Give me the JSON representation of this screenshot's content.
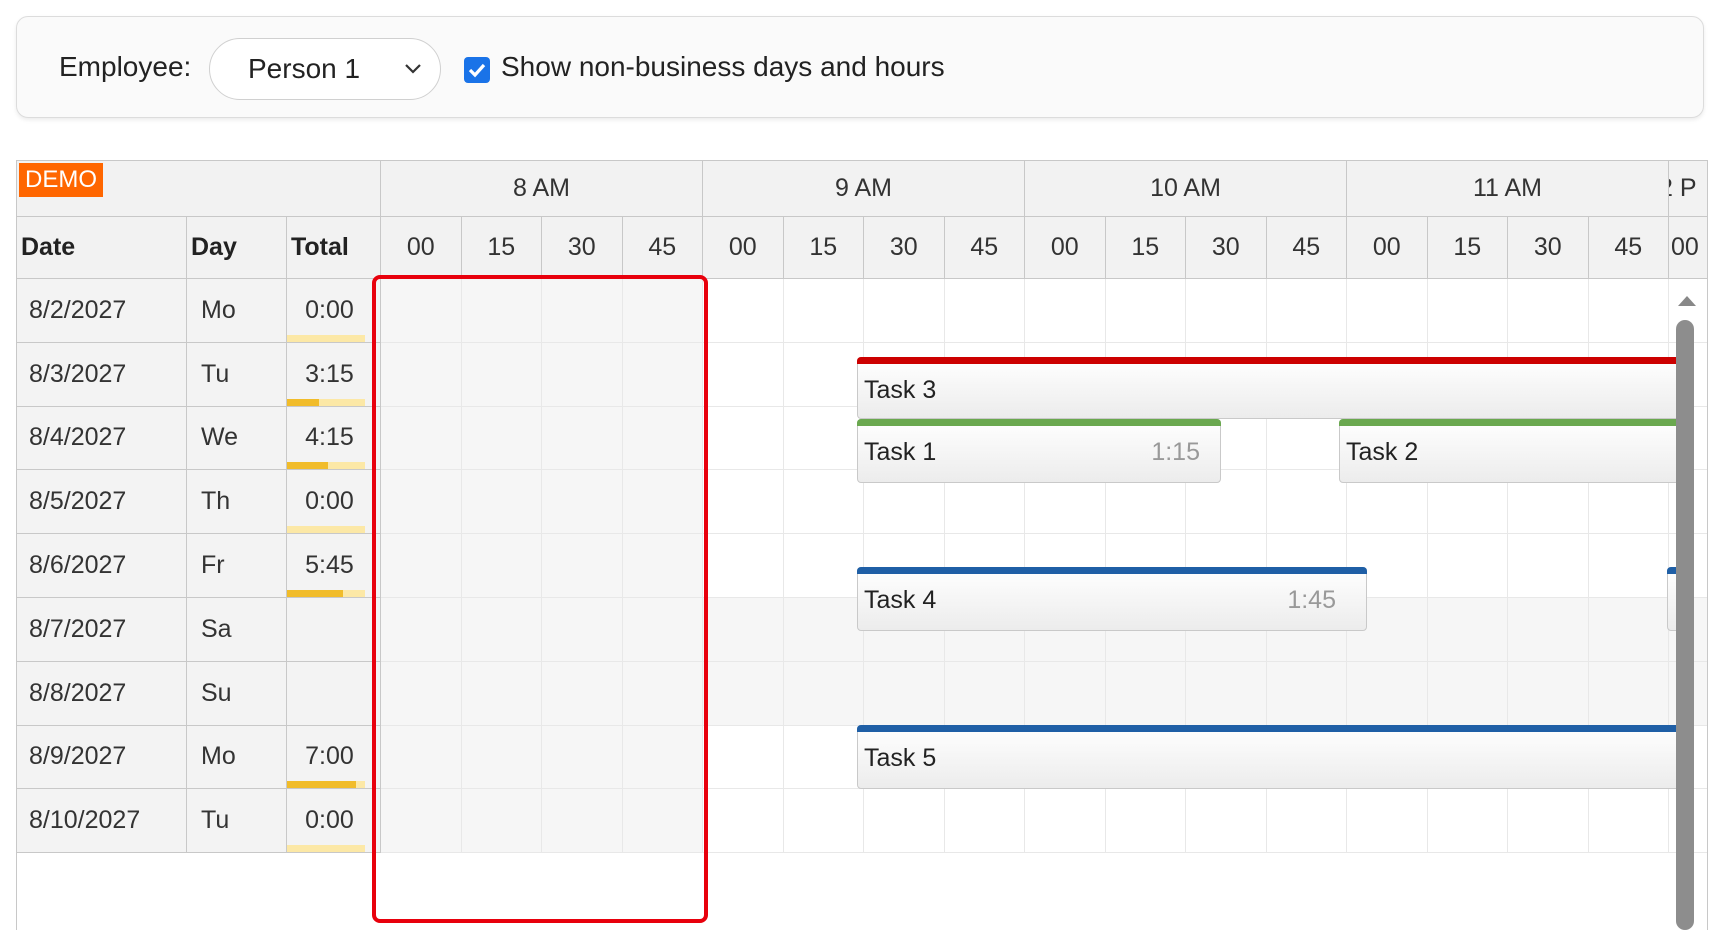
{
  "toolbar": {
    "employee_label": "Employee:",
    "employee_value": "Person 1",
    "show_label": "Show non-business days and hours",
    "show_checked": true
  },
  "scheduler": {
    "demo_badge": "DEMO",
    "columns": {
      "date": "Date",
      "day": "Day",
      "total": "Total"
    },
    "hours": [
      "8 AM",
      "9 AM",
      "10 AM",
      "11 AM",
      "2 P"
    ],
    "minutes": [
      "00",
      "15",
      "30",
      "45",
      "00",
      "15",
      "30",
      "45",
      "00",
      "15",
      "30",
      "45",
      "00",
      "15",
      "30",
      "45",
      "00"
    ],
    "rows": [
      {
        "date": "8/2/2027",
        "day": "Mo",
        "total": "0:00",
        "fill": 0.0,
        "business": true
      },
      {
        "date": "8/3/2027",
        "day": "Tu",
        "total": "3:15",
        "fill": 0.41,
        "business": true
      },
      {
        "date": "8/4/2027",
        "day": "We",
        "total": "4:15",
        "fill": 0.53,
        "business": true
      },
      {
        "date": "8/5/2027",
        "day": "Th",
        "total": "0:00",
        "fill": 0.0,
        "business": true
      },
      {
        "date": "8/6/2027",
        "day": "Fr",
        "total": "5:45",
        "fill": 0.72,
        "business": true
      },
      {
        "date": "8/7/2027",
        "day": "Sa",
        "total": "",
        "fill": null,
        "business": false
      },
      {
        "date": "8/8/2027",
        "day": "Su",
        "total": "",
        "fill": null,
        "business": false
      },
      {
        "date": "8/9/2027",
        "day": "Mo",
        "total": "7:00",
        "fill": 0.88,
        "business": true
      },
      {
        "date": "8/10/2027",
        "day": "Tu",
        "total": "0:00",
        "fill": 0.0,
        "business": true
      }
    ],
    "events": [
      {
        "text": "Task 3",
        "duration": "",
        "color": "#cc0000"
      },
      {
        "text": "Task 1",
        "duration": "1:15",
        "color": "#6aa84f"
      },
      {
        "text": "Task 2",
        "duration": "",
        "color": "#6aa84f"
      },
      {
        "text": "Task 4",
        "duration": "1:45",
        "color": "#1f5fa6"
      },
      {
        "text": "Task 5",
        "duration": "",
        "color": "#1f5fa6"
      }
    ]
  }
}
